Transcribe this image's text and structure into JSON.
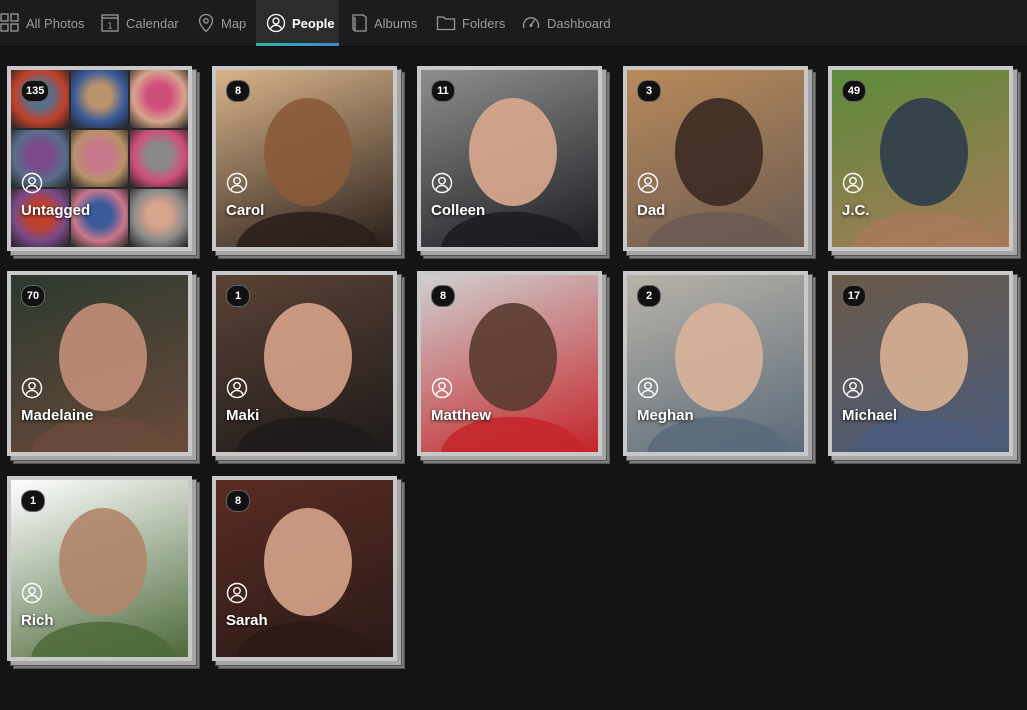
{
  "nav": {
    "tabs": [
      {
        "label": "All Photos",
        "icon": "grid-icon",
        "active": false
      },
      {
        "label": "Calendar",
        "icon": "calendar-icon",
        "active": false
      },
      {
        "label": "Map",
        "icon": "map-pin-icon",
        "active": false
      },
      {
        "label": "People",
        "icon": "person-icon",
        "active": true
      },
      {
        "label": "Albums",
        "icon": "album-icon",
        "active": false
      },
      {
        "label": "Folders",
        "icon": "folder-icon",
        "active": false
      },
      {
        "label": "Dashboard",
        "icon": "gauge-icon",
        "active": false
      }
    ],
    "calendar_icon_text": "1",
    "active_underline_colors": [
      "#2bb5a8",
      "#3e88d6"
    ]
  },
  "people": [
    {
      "name": "Untagged",
      "count": "135",
      "mosaic": true
    },
    {
      "name": "Carol",
      "count": "8"
    },
    {
      "name": "Colleen",
      "count": "11"
    },
    {
      "name": "Dad",
      "count": "3"
    },
    {
      "name": "J.C.",
      "count": "49"
    },
    {
      "name": "Madelaine",
      "count": "70"
    },
    {
      "name": "Maki",
      "count": "1"
    },
    {
      "name": "Matthew",
      "count": "8"
    },
    {
      "name": "Meghan",
      "count": "2"
    },
    {
      "name": "Michael",
      "count": "17"
    },
    {
      "name": "Rich",
      "count": "1"
    },
    {
      "name": "Sarah",
      "count": "8"
    }
  ]
}
